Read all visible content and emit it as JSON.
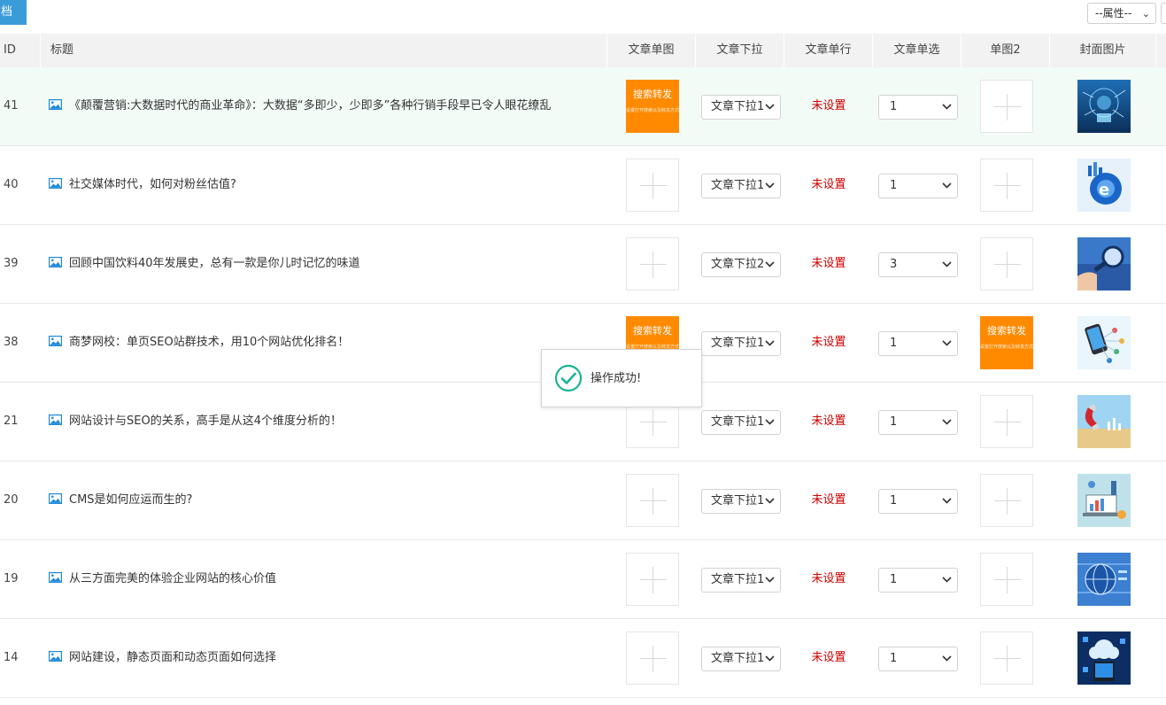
{
  "header": {
    "tab_label": "档",
    "attribute_select": "--属性--"
  },
  "columns": {
    "id": "ID",
    "title": "标题",
    "image_single": "文章单图",
    "dropdown": "文章下拉",
    "single_line": "文章单行",
    "radio": "文章单选",
    "image2": "单图2",
    "cover": "封面图片"
  },
  "promo_thumb": {
    "title": "搜索转发",
    "subtitle": "设置打开搜索以及转发方式"
  },
  "rows": [
    {
      "id": "41",
      "title": "《颠覆营销:大数据时代的商业革命》：大数据“多即少，少即多”各种行销手段早已令人眼花缭乱",
      "dropdown": "文章下拉1",
      "line": "未设置",
      "radio": "1",
      "image_single": "promo",
      "image2": "empty",
      "cover": "cloud-tech"
    },
    {
      "id": "40",
      "title": "社交媒体时代，如何对粉丝估值?",
      "dropdown": "文章下拉1",
      "line": "未设置",
      "radio": "1",
      "image_single": "empty",
      "image2": "empty",
      "cover": "ie-globe"
    },
    {
      "id": "39",
      "title": "回顾中国饮料40年发展史，总有一款是你儿时记忆的味道",
      "dropdown": "文章下拉2",
      "line": "未设置",
      "radio": "3",
      "image_single": "empty",
      "image2": "empty",
      "cover": "magnifier-hand"
    },
    {
      "id": "38",
      "title": "商梦网校：单页SEO站群技术，用10个网站优化排名！",
      "dropdown": "文章下拉1",
      "line": "未设置",
      "radio": "1",
      "image_single": "promo",
      "image2": "promo",
      "cover": "phone-network"
    },
    {
      "id": "21",
      "title": "网站设计与SEO的关系，高手是从这4个维度分析的！",
      "dropdown": "文章下拉1",
      "line": "未设置",
      "radio": "1",
      "image_single": "empty",
      "image2": "empty",
      "cover": "magnet"
    },
    {
      "id": "20",
      "title": "CMS是如何应运而生的?",
      "dropdown": "文章下拉1",
      "line": "未设置",
      "radio": "1",
      "image_single": "empty",
      "image2": "empty",
      "cover": "laptop-chart"
    },
    {
      "id": "19",
      "title": "从三方面完美的体验企业网站的核心价值",
      "dropdown": "文章下拉1",
      "line": "未设置",
      "radio": "1",
      "image_single": "empty",
      "image2": "empty",
      "cover": "globe-blue"
    },
    {
      "id": "14",
      "title": "网站建设，静态页面和动态页面如何选择",
      "dropdown": "文章下拉1",
      "line": "未设置",
      "radio": "1",
      "image_single": "empty",
      "image2": "empty",
      "cover": "tablet-cloud"
    }
  ],
  "toast": {
    "message": "操作成功!",
    "icon": "check-circle-icon",
    "color": "#1ab394"
  },
  "colors": {
    "accent": "#3a9bd9",
    "warning_text": "#cc0000",
    "promo": "#ff8a00",
    "highlight_row": "#f3fbf7"
  }
}
